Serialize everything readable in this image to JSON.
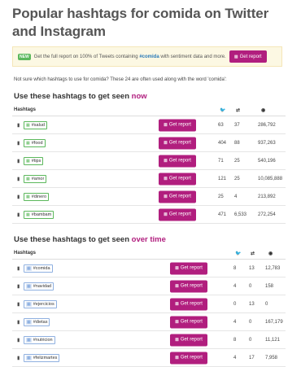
{
  "title": "Popular hashtags for comida on Twitter and Instagram",
  "banner": {
    "badge": "NEW",
    "text_before": "Get the full report on 100% of Tweets containing",
    "hashtag": "#comida",
    "text_after": "with sentiment data and more.",
    "button": "Get report"
  },
  "note": "Not sure which hashtags to use for comida? These 24 are often used along with the word 'comida':",
  "section1": {
    "heading_start": "Use these hashtags to get seen ",
    "heading_highlight": "now",
    "col_label": "Hashtags",
    "rows": [
      {
        "tag": "#salud",
        "a": "63",
        "b": "37",
        "c": "286,792",
        "button": "Get report"
      },
      {
        "tag": "#food",
        "a": "404",
        "b": "88",
        "c": "937,263",
        "button": "Get report"
      },
      {
        "tag": "#tips",
        "a": "71",
        "b": "25",
        "c": "540,196",
        "button": "Get report"
      },
      {
        "tag": "#amor",
        "a": "121",
        "b": "25",
        "c": "10,085,888",
        "button": "Get report"
      },
      {
        "tag": "#dinero",
        "a": "25",
        "b": "4",
        "c": "213,892",
        "button": "Get report"
      },
      {
        "tag": "#bambam",
        "a": "471",
        "b": "6,533",
        "c": "272,254",
        "button": "Get report"
      }
    ]
  },
  "section2": {
    "heading_start": "Use these hashtags to get seen ",
    "heading_highlight": "over time",
    "col_label": "Hashtags",
    "rows": [
      {
        "tag": "#comida",
        "a": "8",
        "b": "13",
        "c": "12,783",
        "button": "Get report"
      },
      {
        "tag": "#navidad",
        "a": "4",
        "b": "0",
        "c": "158",
        "button": "Get report"
      },
      {
        "tag": "#ejercicios",
        "a": "0",
        "b": "13",
        "c": "0",
        "button": "Get report"
      },
      {
        "tag": "#dietas",
        "a": "4",
        "b": "0",
        "c": "167,179",
        "button": "Get report"
      },
      {
        "tag": "#nutricion",
        "a": "8",
        "b": "0",
        "c": "11,121",
        "button": "Get report"
      },
      {
        "tag": "#felizmartes",
        "a": "4",
        "b": "17",
        "c": "7,958",
        "button": "Get report"
      }
    ]
  },
  "colors": {
    "accent": "#b11e7e",
    "green": "#5cb85c",
    "blue": "#6f9ad8",
    "banner_bg": "#fcf8e3"
  },
  "icons": {
    "tweets": "twitter-icon",
    "retweets": "retweet-icon",
    "views": "eye-icon",
    "bookmark": "bookmark-icon",
    "chart": "bar-chart-icon"
  }
}
